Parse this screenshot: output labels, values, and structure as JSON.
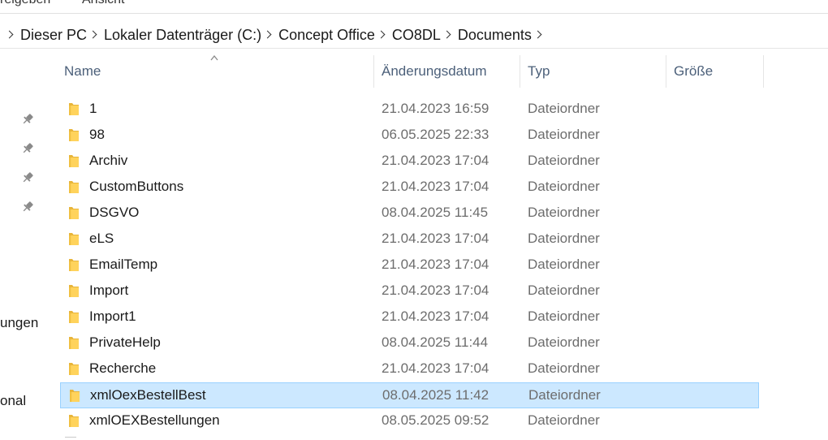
{
  "ribbon": {
    "tabs": [
      "reigeben",
      "Ansicht"
    ]
  },
  "breadcrumb": [
    "Dieser PC",
    "Lokaler Datenträger (C:)",
    "Concept Office",
    "CO8DL",
    "Documents"
  ],
  "nav": {
    "partial_items": [
      "ungen",
      "onal"
    ]
  },
  "columns": {
    "name": "Name",
    "date": "Änderungsdatum",
    "type": "Typ",
    "size": "Größe"
  },
  "files": [
    {
      "name": "1",
      "date": "21.04.2023 16:59",
      "type": "Dateiordner"
    },
    {
      "name": "98",
      "date": "06.05.2025 22:33",
      "type": "Dateiordner"
    },
    {
      "name": "Archiv",
      "date": "21.04.2023 17:04",
      "type": "Dateiordner"
    },
    {
      "name": "CustomButtons",
      "date": "21.04.2023 17:04",
      "type": "Dateiordner"
    },
    {
      "name": "DSGVO",
      "date": "08.04.2025 11:45",
      "type": "Dateiordner"
    },
    {
      "name": "eLS",
      "date": "21.04.2023 17:04",
      "type": "Dateiordner"
    },
    {
      "name": "EmailTemp",
      "date": "21.04.2023 17:04",
      "type": "Dateiordner"
    },
    {
      "name": "Import",
      "date": "21.04.2023 17:04",
      "type": "Dateiordner"
    },
    {
      "name": "Import1",
      "date": "21.04.2023 17:04",
      "type": "Dateiordner"
    },
    {
      "name": "PrivateHelp",
      "date": "08.04.2025 11:44",
      "type": "Dateiordner"
    },
    {
      "name": "Recherche",
      "date": "21.04.2023 17:04",
      "type": "Dateiordner"
    },
    {
      "name": "xmlOexBestellBest",
      "date": "08.04.2025 11:42",
      "type": "Dateiordner",
      "selected": true
    },
    {
      "name": "xmlOEXBestellungen",
      "date": "08.05.2025 09:52",
      "type": "Dateiordner"
    }
  ],
  "colors": {
    "selection": "#cce8ff",
    "selection_border": "#99d1ff",
    "folder": "#ffd35c",
    "header_text": "#4c607a"
  }
}
